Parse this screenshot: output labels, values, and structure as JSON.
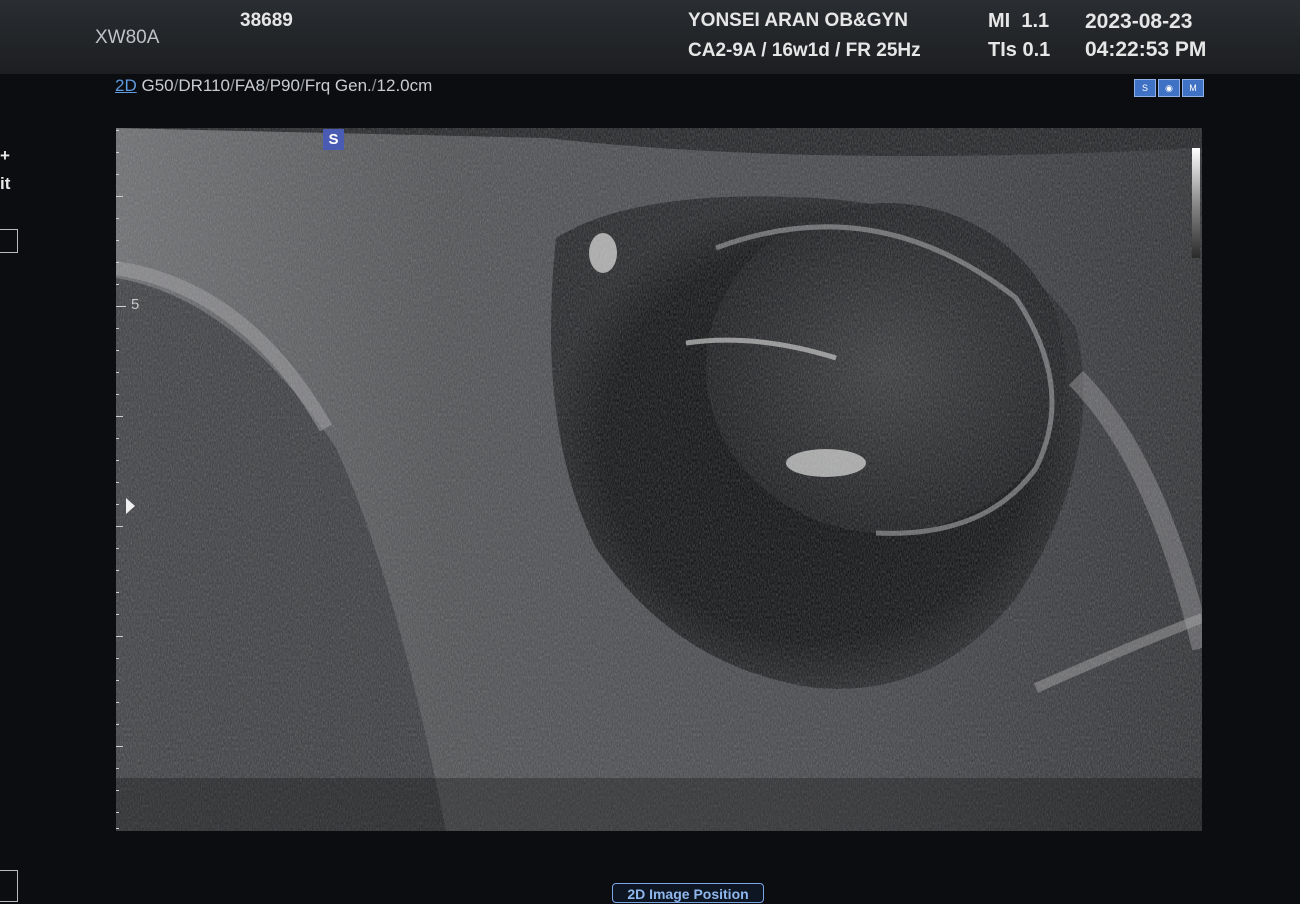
{
  "header": {
    "model": "XW80A",
    "patient_id": "38689",
    "institution": "YONSEI ARAN OB&GYN",
    "probe_info": "CA2-9A / 16w1d / FR 25Hz",
    "mi_label": "MI",
    "mi_value": "1.1",
    "tis_label": "TIs",
    "tis_value": "0.1",
    "date": "2023-08-23",
    "time": "04:22:53 PM"
  },
  "params": {
    "mode": "2D",
    "gain": "G50",
    "dr": "DR110",
    "fa": "FA8",
    "power": "P90",
    "frequency": "Frq Gen.",
    "depth": "12.0cm"
  },
  "mode_icons": [
    "S Har",
    "fetal-icon",
    "M"
  ],
  "left_edge": {
    "plus": "+",
    "fragment": "it"
  },
  "scan": {
    "depth_marker_label": "5",
    "steer_badge": "S"
  },
  "footer": {
    "position_button": "2D Image Position"
  }
}
